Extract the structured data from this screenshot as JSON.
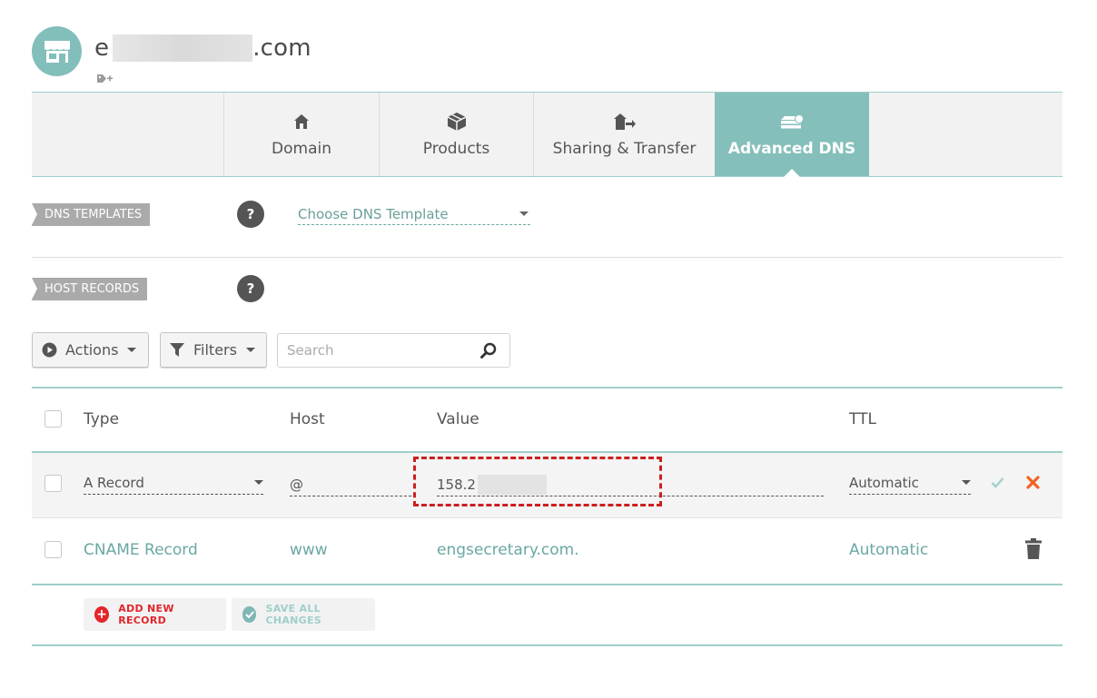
{
  "header": {
    "domain_prefix": "e",
    "domain_suffix": ".com",
    "store_icon": "storefront-icon",
    "tag_icon": "tag-plus-icon"
  },
  "tabs": [
    {
      "label": "Domain",
      "icon": "home-icon",
      "active": false
    },
    {
      "label": "Products",
      "icon": "box-icon",
      "active": false
    },
    {
      "label": "Sharing & Transfer",
      "icon": "transfer-icon",
      "active": false
    },
    {
      "label": "Advanced DNS",
      "icon": "server-icon",
      "active": true
    }
  ],
  "dns_templates": {
    "label": "DNS TEMPLATES",
    "help": "?",
    "select_value": "Choose DNS Template"
  },
  "host_records": {
    "label": "HOST RECORDS",
    "help": "?"
  },
  "toolbar": {
    "actions_label": "Actions",
    "filters_label": "Filters",
    "search_placeholder": "Search"
  },
  "table": {
    "headers": {
      "type": "Type",
      "host": "Host",
      "value": "Value",
      "ttl": "TTL"
    },
    "edit_row": {
      "type": "A Record",
      "host": "@",
      "value_prefix": "158.2",
      "ttl": "Automatic"
    },
    "rows": [
      {
        "type": "CNAME Record",
        "host": "www",
        "value": "engsecretary.com.",
        "ttl": "Automatic"
      }
    ]
  },
  "actions": {
    "add_label": "ADD NEW RECORD",
    "save_label": "SAVE ALL CHANGES"
  },
  "colors": {
    "accent": "#85bfbb",
    "danger": "#e2262a",
    "cancel_x": "#f26322",
    "highlight": "#cc1f1f"
  }
}
